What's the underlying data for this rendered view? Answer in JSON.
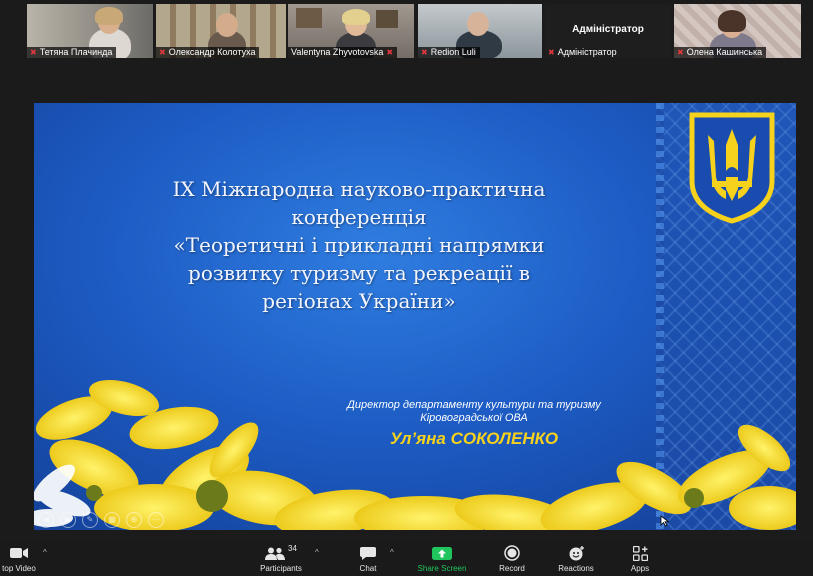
{
  "participants": [
    {
      "name": "Тетяна Плачинда"
    },
    {
      "name": "Олександр Колотуха"
    },
    {
      "name": "Valentyna Zhyvotovska"
    },
    {
      "name": "Redion Luli"
    },
    {
      "name": "Адміністратор",
      "label": "Адміністратор"
    },
    {
      "name": "Олена Кашинська"
    }
  ],
  "slide": {
    "title_lines": [
      "IX Міжнародна науково-практична",
      "конференція",
      "«Теоретичні і прикладні напрямки",
      "розвитку туризму та рекреації в",
      "регіонах України»"
    ],
    "director_line1": "Директор департаменту культури та туризму",
    "director_line2": "Кіровоградської ОВА",
    "speaker": "Ул’яна СОКОЛЕНКО",
    "colors": {
      "background": "#1d5cc4",
      "accent": "#f6d21c"
    }
  },
  "toolbar": {
    "video_label": "top Video",
    "participants_label": "Participants",
    "participants_count": "34",
    "chat_label": "Chat",
    "share_label": "Share Screen",
    "record_label": "Record",
    "reactions_label": "Reactions",
    "apps_label": "Apps"
  }
}
